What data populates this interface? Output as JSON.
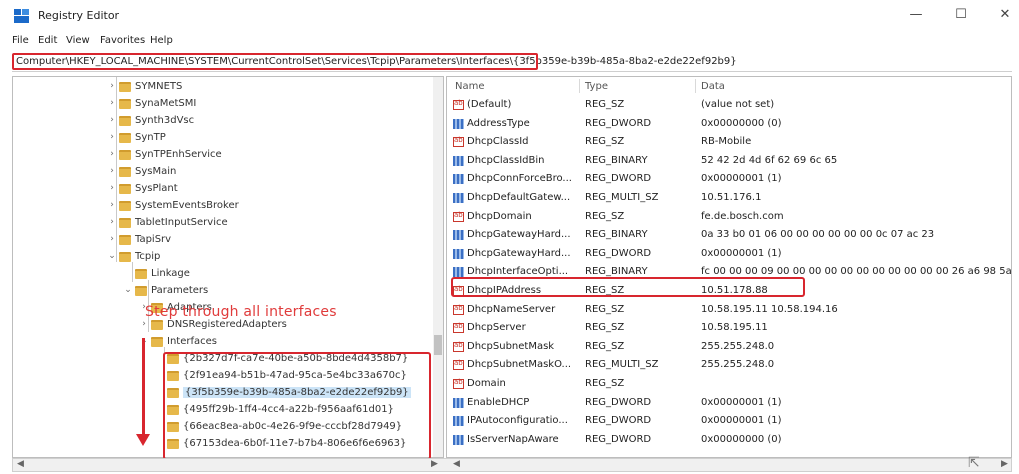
{
  "window": {
    "title": "Registry Editor",
    "minimize": "—",
    "maximize": "☐",
    "close": "✕"
  },
  "menu": [
    "File",
    "Edit",
    "View",
    "Favorites",
    "Help"
  ],
  "address": {
    "highlighted": "Computer\\HKEY_LOCAL_MACHINE\\SYSTEM\\CurrentControlSet\\Services\\Tcpip\\Parameters\\Interfaces\\",
    "rest": "{3f5b359e-b39b-485a-8ba2-e2de22ef92b9}"
  },
  "tree": [
    {
      "label": "SYMNETS",
      "expander": ">"
    },
    {
      "label": "SynaMetSMI",
      "expander": ">"
    },
    {
      "label": "Synth3dVsc",
      "expander": ">"
    },
    {
      "label": "SynTP",
      "expander": ">"
    },
    {
      "label": "SynTPEnhService",
      "expander": ">"
    },
    {
      "label": "SysMain",
      "expander": ">"
    },
    {
      "label": "SysPlant",
      "expander": ">"
    },
    {
      "label": "SystemEventsBroker",
      "expander": ">"
    },
    {
      "label": "TabletInputService",
      "expander": ">"
    },
    {
      "label": "TapiSrv",
      "expander": ">"
    },
    {
      "label": "Tcpip",
      "expander": "v"
    },
    {
      "label": "Linkage",
      "expander": ""
    },
    {
      "label": "Parameters",
      "expander": "v"
    },
    {
      "label": "Adapters",
      "expander": ">"
    },
    {
      "label": "DNSRegisteredAdapters",
      "expander": ">"
    },
    {
      "label": "Interfaces",
      "expander": "v"
    },
    {
      "label": "{2b327d7f-ca7e-40be-a50b-8bde4d4358b7}",
      "expander": ""
    },
    {
      "label": "{2f91ea94-b51b-47ad-95ca-5e4bc33a670c}",
      "expander": ""
    },
    {
      "label": "{3f5b359e-b39b-485a-8ba2-e2de22ef92b9}",
      "expander": "",
      "selected": true
    },
    {
      "label": "{495ff29b-1ff4-4cc4-a22b-f956aaf61d01}",
      "expander": ""
    },
    {
      "label": "{66eac8ea-ab0c-4e26-9f9e-cccbf28d7949}",
      "expander": ""
    },
    {
      "label": "{67153dea-6b0f-11e7-b7b4-806e6f6e6963}",
      "expander": ""
    }
  ],
  "annotation": {
    "text": "Step through all interfaces",
    "color": "#e03b3b"
  },
  "list": {
    "columns": [
      "Name",
      "Type",
      "Data"
    ],
    "rows": [
      {
        "icon": "sz",
        "name": "(Default)",
        "type": "REG_SZ",
        "data": "(value not set)"
      },
      {
        "icon": "bin",
        "name": "AddressType",
        "type": "REG_DWORD",
        "data": "0x00000000 (0)"
      },
      {
        "icon": "sz",
        "name": "DhcpClassId",
        "type": "REG_SZ",
        "data": "RB-Mobile"
      },
      {
        "icon": "bin",
        "name": "DhcpClassIdBin",
        "type": "REG_BINARY",
        "data": "52 42 2d 4d 6f 62 69 6c 65"
      },
      {
        "icon": "bin",
        "name": "DhcpConnForceBro...",
        "type": "REG_DWORD",
        "data": "0x00000001 (1)"
      },
      {
        "icon": "bin",
        "name": "DhcpDefaultGatew...",
        "type": "REG_MULTI_SZ",
        "data": "10.51.176.1"
      },
      {
        "icon": "sz",
        "name": "DhcpDomain",
        "type": "REG_SZ",
        "data": "fe.de.bosch.com"
      },
      {
        "icon": "bin",
        "name": "DhcpGatewayHard...",
        "type": "REG_BINARY",
        "data": "0a 33 b0 01 06 00 00 00 00 00 00 0c 07 ac 23"
      },
      {
        "icon": "bin",
        "name": "DhcpGatewayHard...",
        "type": "REG_DWORD",
        "data": "0x00000001 (1)"
      },
      {
        "icon": "bin",
        "name": "DhcpInterfaceOpti...",
        "type": "REG_BINARY",
        "data": "fc 00 00 00 09 00 00 00 00 00 00 00 00 00 00 00 26 a6 98 5a"
      },
      {
        "icon": "sz",
        "name": "DhcpIPAddress",
        "type": "REG_SZ",
        "data": "10.51.178.88"
      },
      {
        "icon": "sz",
        "name": "DhcpNameServer",
        "type": "REG_SZ",
        "data": "10.58.195.11 10.58.194.16"
      },
      {
        "icon": "sz",
        "name": "DhcpServer",
        "type": "REG_SZ",
        "data": "10.58.195.11"
      },
      {
        "icon": "sz",
        "name": "DhcpSubnetMask",
        "type": "REG_SZ",
        "data": "255.255.248.0"
      },
      {
        "icon": "sz",
        "name": "DhcpSubnetMaskO...",
        "type": "REG_MULTI_SZ",
        "data": "255.255.248.0"
      },
      {
        "icon": "sz",
        "name": "Domain",
        "type": "REG_SZ",
        "data": ""
      },
      {
        "icon": "bin",
        "name": "EnableDHCP",
        "type": "REG_DWORD",
        "data": "0x00000001 (1)"
      },
      {
        "icon": "bin",
        "name": "IPAutoconfiguratio...",
        "type": "REG_DWORD",
        "data": "0x00000001 (1)"
      },
      {
        "icon": "bin",
        "name": "IsServerNapAware",
        "type": "REG_DWORD",
        "data": "0x00000000 (0)"
      }
    ]
  }
}
